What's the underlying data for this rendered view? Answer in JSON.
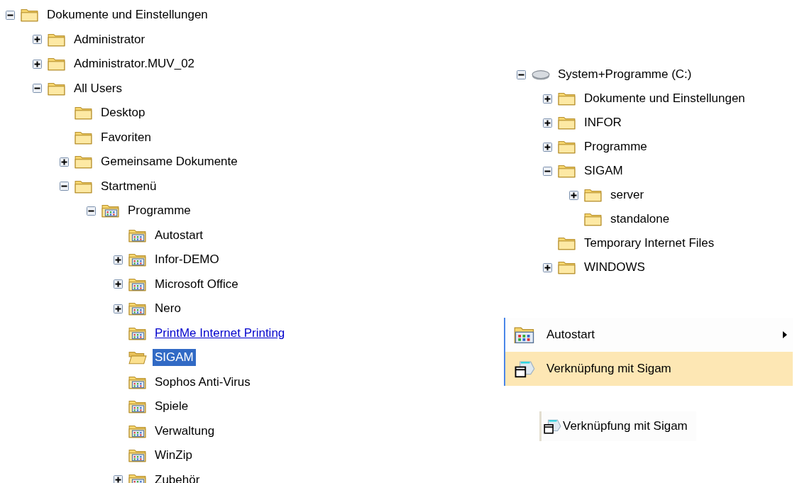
{
  "explorer_tree": {
    "items": [
      {
        "label": "Dokumente und Einstellungen",
        "kind": "folder",
        "expanded": true,
        "selected": false,
        "hot": false,
        "children": [
          {
            "label": "Administrator",
            "kind": "folder",
            "expanded": false,
            "selected": false,
            "hot": false
          },
          {
            "label": "Administrator.MUV_02",
            "kind": "folder",
            "expanded": false,
            "selected": false,
            "hot": false
          },
          {
            "label": "All Users",
            "kind": "folder",
            "expanded": true,
            "selected": false,
            "hot": false,
            "children": [
              {
                "label": "Desktop",
                "kind": "folder",
                "selected": false,
                "hot": false
              },
              {
                "label": "Favoriten",
                "kind": "folder",
                "selected": false,
                "hot": false
              },
              {
                "label": "Gemeinsame Dokumente",
                "kind": "folder",
                "expanded": false,
                "selected": false,
                "hot": false
              },
              {
                "label": "Startmenü",
                "kind": "folder",
                "expanded": true,
                "selected": false,
                "hot": false,
                "children": [
                  {
                    "label": "Programme",
                    "kind": "program-folder",
                    "expanded": true,
                    "selected": false,
                    "hot": false,
                    "children": [
                      {
                        "label": "Autostart",
                        "kind": "program-folder",
                        "selected": false,
                        "hot": false
                      },
                      {
                        "label": "Infor-DEMO",
                        "kind": "program-folder",
                        "expanded": false,
                        "selected": false,
                        "hot": false
                      },
                      {
                        "label": "Microsoft Office",
                        "kind": "program-folder",
                        "expanded": false,
                        "selected": false,
                        "hot": false
                      },
                      {
                        "label": "Nero",
                        "kind": "program-folder",
                        "expanded": false,
                        "selected": false,
                        "hot": false
                      },
                      {
                        "label": "PrintMe Internet Printing",
                        "kind": "program-folder",
                        "selected": false,
                        "hot": true
                      },
                      {
                        "label": "SIGAM",
                        "kind": "folder",
                        "selected": true,
                        "hot": false
                      },
                      {
                        "label": "Sophos Anti-Virus",
                        "kind": "program-folder",
                        "selected": false,
                        "hot": false
                      },
                      {
                        "label": "Spiele",
                        "kind": "program-folder",
                        "selected": false,
                        "hot": false
                      },
                      {
                        "label": "Verwaltung",
                        "kind": "program-folder",
                        "selected": false,
                        "hot": false
                      },
                      {
                        "label": "WinZip",
                        "kind": "program-folder",
                        "selected": false,
                        "hot": false
                      },
                      {
                        "label": "Zubehör",
                        "kind": "program-folder",
                        "expanded": false,
                        "selected": false,
                        "hot": false
                      }
                    ]
                  }
                ]
              }
            ]
          }
        ]
      }
    ]
  },
  "drive_tree": {
    "items": [
      {
        "label": "System+Programme (C:)",
        "kind": "drive",
        "expanded": true,
        "selected": false,
        "hot": false,
        "children": [
          {
            "label": "Dokumente und Einstellungen",
            "kind": "folder",
            "expanded": false,
            "selected": false,
            "hot": false
          },
          {
            "label": "INFOR",
            "kind": "folder",
            "expanded": false,
            "selected": false,
            "hot": false
          },
          {
            "label": "Programme",
            "kind": "folder",
            "expanded": false,
            "selected": false,
            "hot": false
          },
          {
            "label": "SIGAM",
            "kind": "folder",
            "expanded": true,
            "selected": false,
            "hot": false,
            "children": [
              {
                "label": "server",
                "kind": "folder",
                "expanded": false,
                "selected": false,
                "hot": false
              },
              {
                "label": "standalone",
                "kind": "folder",
                "selected": false,
                "hot": false
              }
            ]
          },
          {
            "label": "Temporary Internet Files",
            "kind": "folder",
            "selected": false,
            "hot": false
          },
          {
            "label": "WINDOWS",
            "kind": "folder",
            "expanded": false,
            "selected": false,
            "hot": false
          }
        ]
      }
    ]
  },
  "start_menu": {
    "items": [
      {
        "label": "Autostart",
        "kind": "program-folder",
        "has_submenu": true,
        "selected": false
      },
      {
        "label": "Verknüpfung mit Sigam",
        "kind": "shortcut",
        "has_submenu": false,
        "selected": true
      }
    ]
  },
  "desktop_shortcut": {
    "label": "Verknüpfung mit Sigam"
  }
}
